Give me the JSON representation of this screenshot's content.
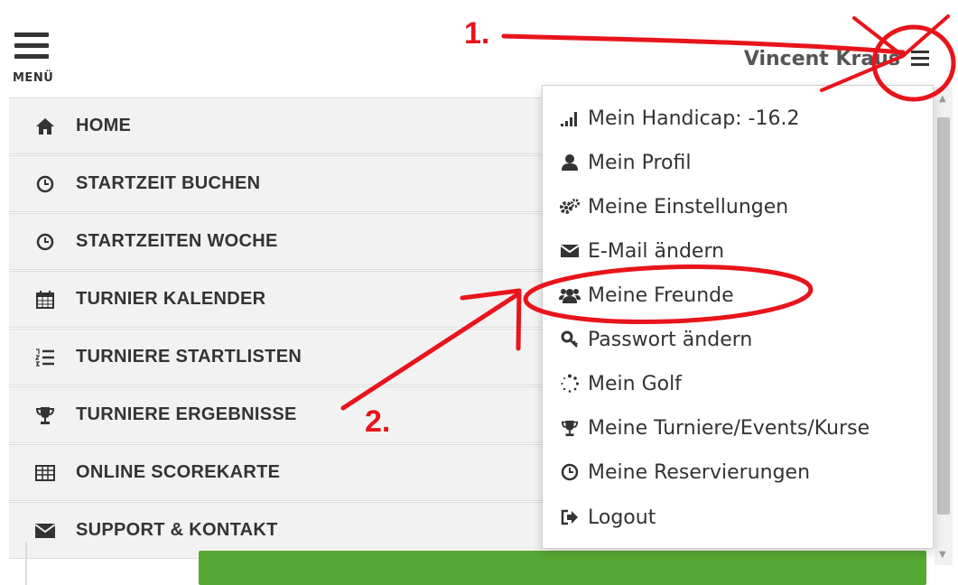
{
  "header": {
    "menu_label": "MENÜ",
    "user_name": "Vincent Kraus"
  },
  "sidebar": {
    "items": [
      {
        "label": "HOME",
        "icon": "home-icon"
      },
      {
        "label": "STARTZEIT BUCHEN",
        "icon": "clock-icon"
      },
      {
        "label": "STARTZEITEN WOCHE",
        "icon": "clock-icon"
      },
      {
        "label": "TURNIER KALENDER",
        "icon": "calendar-icon"
      },
      {
        "label": "TURNIERE STARTLISTEN",
        "icon": "list-ordered-icon"
      },
      {
        "label": "TURNIERE ERGEBNISSE",
        "icon": "trophy-icon"
      },
      {
        "label": "ONLINE SCOREKARTE",
        "icon": "table-icon"
      },
      {
        "label": "SUPPORT & KONTAKT",
        "icon": "envelope-icon"
      }
    ]
  },
  "dropdown": {
    "items": [
      {
        "label": "Mein Handicap: -16.2",
        "icon": "signal-bars-icon"
      },
      {
        "label": "Mein Profil",
        "icon": "user-icon"
      },
      {
        "label": "Meine Einstellungen",
        "icon": "gears-icon"
      },
      {
        "label": "E-Mail ändern",
        "icon": "envelope-icon"
      },
      {
        "label": "Meine Freunde",
        "icon": "users-icon"
      },
      {
        "label": "Passwort ändern",
        "icon": "key-icon"
      },
      {
        "label": "Mein Golf",
        "icon": "spinner-icon"
      },
      {
        "label": "Meine Turniere/Events/Kurse",
        "icon": "trophy-icon"
      },
      {
        "label": "Meine Reservierungen",
        "icon": "clock-icon"
      },
      {
        "label": "Logout",
        "icon": "sign-out-icon"
      }
    ]
  },
  "annotations": {
    "step1": "1.",
    "step2": "2.",
    "color": "#e8141b"
  },
  "colors": {
    "accent_green": "#56a834",
    "sidebar_bg": "#f2f2f2"
  }
}
